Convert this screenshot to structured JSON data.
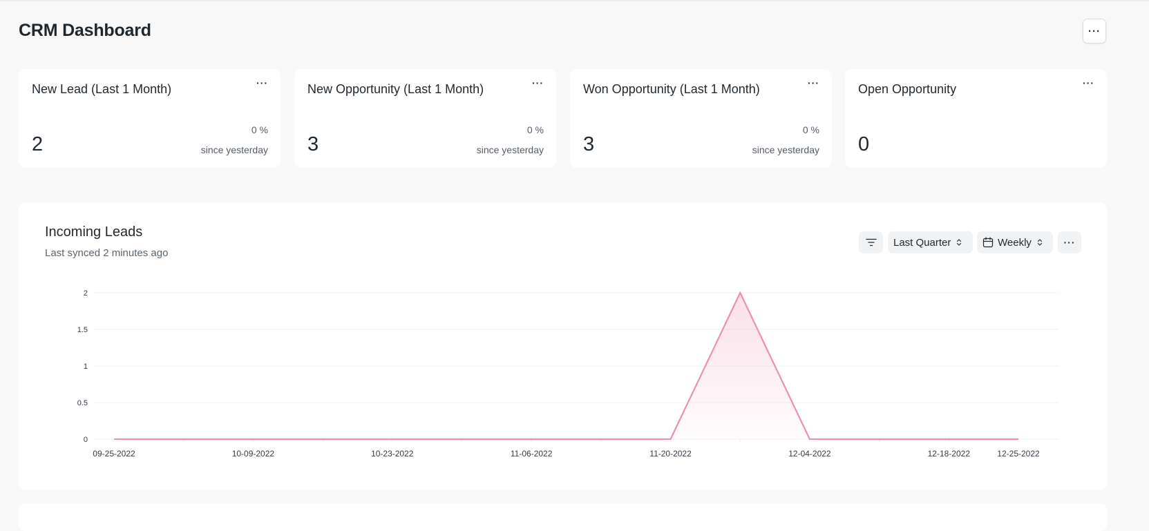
{
  "header": {
    "title": "CRM Dashboard",
    "menu_label": "···"
  },
  "cards": [
    {
      "title": "New Lead (Last 1 Month)",
      "value": "2",
      "change": "0 %",
      "since": "since yesterday",
      "menu_label": "···"
    },
    {
      "title": "New Opportunity (Last 1 Month)",
      "value": "3",
      "change": "0 %",
      "since": "since yesterday",
      "menu_label": "···"
    },
    {
      "title": "Won Opportunity (Last 1 Month)",
      "value": "3",
      "change": "0 %",
      "since": "since yesterday",
      "menu_label": "···"
    },
    {
      "title": "Open Opportunity",
      "value": "0",
      "menu_label": "···"
    }
  ],
  "chart_card": {
    "title": "Incoming Leads",
    "subtitle": "Last synced 2 minutes ago",
    "filter_icon": "filter-icon",
    "period": "Last Quarter",
    "interval": "Weekly",
    "interval_icon": "calendar-icon",
    "more_label": "···"
  },
  "colors": {
    "line": "#ec8fb0",
    "area": "#fdecf2",
    "grid": "#edf0f2",
    "axis_text": "#313b44"
  },
  "chart_data": {
    "type": "area",
    "title": "Incoming Leads",
    "xlabel": "",
    "ylabel": "",
    "ylim": [
      0,
      2
    ],
    "yticks": [
      0,
      0.5,
      1,
      1.5,
      2
    ],
    "x": [
      "09-25-2022",
      "10-02-2022",
      "10-09-2022",
      "10-16-2022",
      "10-23-2022",
      "10-30-2022",
      "11-06-2022",
      "11-13-2022",
      "11-20-2022",
      "11-27-2022",
      "12-04-2022",
      "12-11-2022",
      "12-18-2022",
      "12-25-2022"
    ],
    "xtick_labels": [
      "09-25-2022",
      "10-09-2022",
      "10-23-2022",
      "11-06-2022",
      "11-20-2022",
      "12-04-2022",
      "12-18-2022",
      "12-25-2022"
    ],
    "series": [
      {
        "values": [
          0,
          0,
          0,
          0,
          0,
          0,
          0,
          0,
          0,
          2,
          0,
          0,
          0,
          0
        ]
      }
    ],
    "grid": true
  }
}
